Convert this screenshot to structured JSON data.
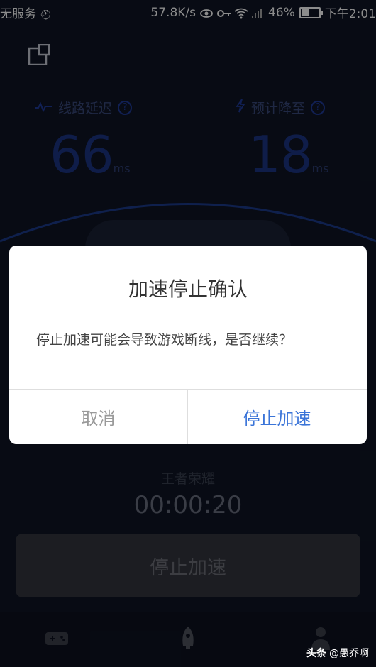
{
  "status_bar": {
    "carrier": "无服务",
    "speed": "57.8K/s",
    "battery": "46%",
    "battery_level": 0.46,
    "time": "下午2:01"
  },
  "stats": {
    "latency": {
      "label": "线路延迟",
      "value": "66",
      "unit": "ms",
      "help": "?"
    },
    "expected": {
      "label": "预计降至",
      "value": "18",
      "unit": "ms",
      "help": "?"
    }
  },
  "dialog": {
    "title": "加速停止确认",
    "message": "停止加速可能会导致游戏断线，是否继续？",
    "cancel_label": "取消",
    "confirm_label": "停止加速"
  },
  "session": {
    "game_name": "王者荣耀",
    "timer": "00:00:20",
    "stop_label": "停止加速"
  },
  "nav": {
    "items": [
      {
        "icon": "gamepad-icon"
      },
      {
        "icon": "rocket-icon"
      },
      {
        "icon": "person-icon"
      }
    ]
  },
  "watermark": {
    "brand": "头条",
    "handle": "@愚乔啊"
  },
  "colors": {
    "background": "#0f1525",
    "accent_blue": "#3a74d8",
    "stat_blue": "#1d3585"
  }
}
